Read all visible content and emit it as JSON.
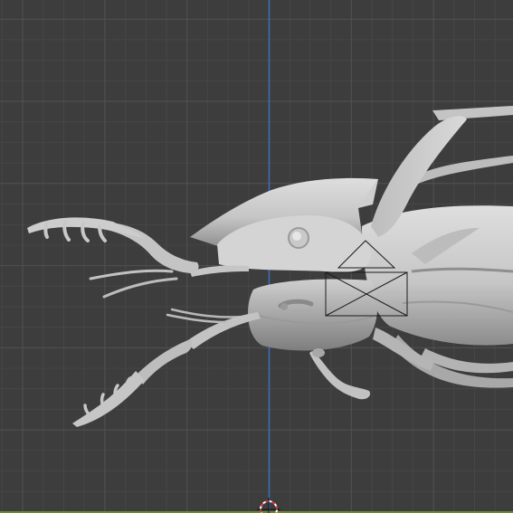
{
  "viewport": {
    "view": "side-orthographic",
    "mode": "object",
    "shading": "solid",
    "grid": true,
    "object": "beetle-model",
    "camera_frame": true,
    "cursor_3d": true
  },
  "colors": {
    "background": "#3d3d3d",
    "grid_minor": "#464646",
    "grid_major": "#525252",
    "axis_z": "#3e6fb8",
    "axis_y": "#6c8a2e",
    "mesh_light": "#d0d0d0",
    "mesh_mid": "#a8a8a8",
    "mesh_dark": "#7a7a7a",
    "camera": "#1c1c1c",
    "cursor_red": "#e23b3b"
  }
}
